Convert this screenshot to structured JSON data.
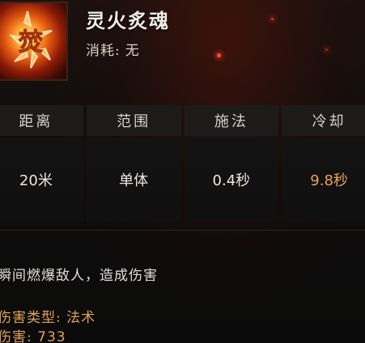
{
  "skill": {
    "name": "灵火炙魂",
    "icon": "flame-skill-icon",
    "cost_label": "消耗:",
    "cost_value": "无"
  },
  "stats": {
    "headers": [
      "距离",
      "范围",
      "施法",
      "冷却"
    ],
    "values": [
      "20米",
      "单体",
      "0.4秒",
      "9.8秒"
    ]
  },
  "description": "瞬间燃爆敌人，造成伤害",
  "damage_type": {
    "label": "伤害类型:",
    "value": "法术"
  },
  "damage": {
    "label": "伤害:",
    "value": "733"
  },
  "colors": {
    "highlight": "#e0a255",
    "cooldown": "#e8a057",
    "header_bg": "#1d1b1a"
  }
}
